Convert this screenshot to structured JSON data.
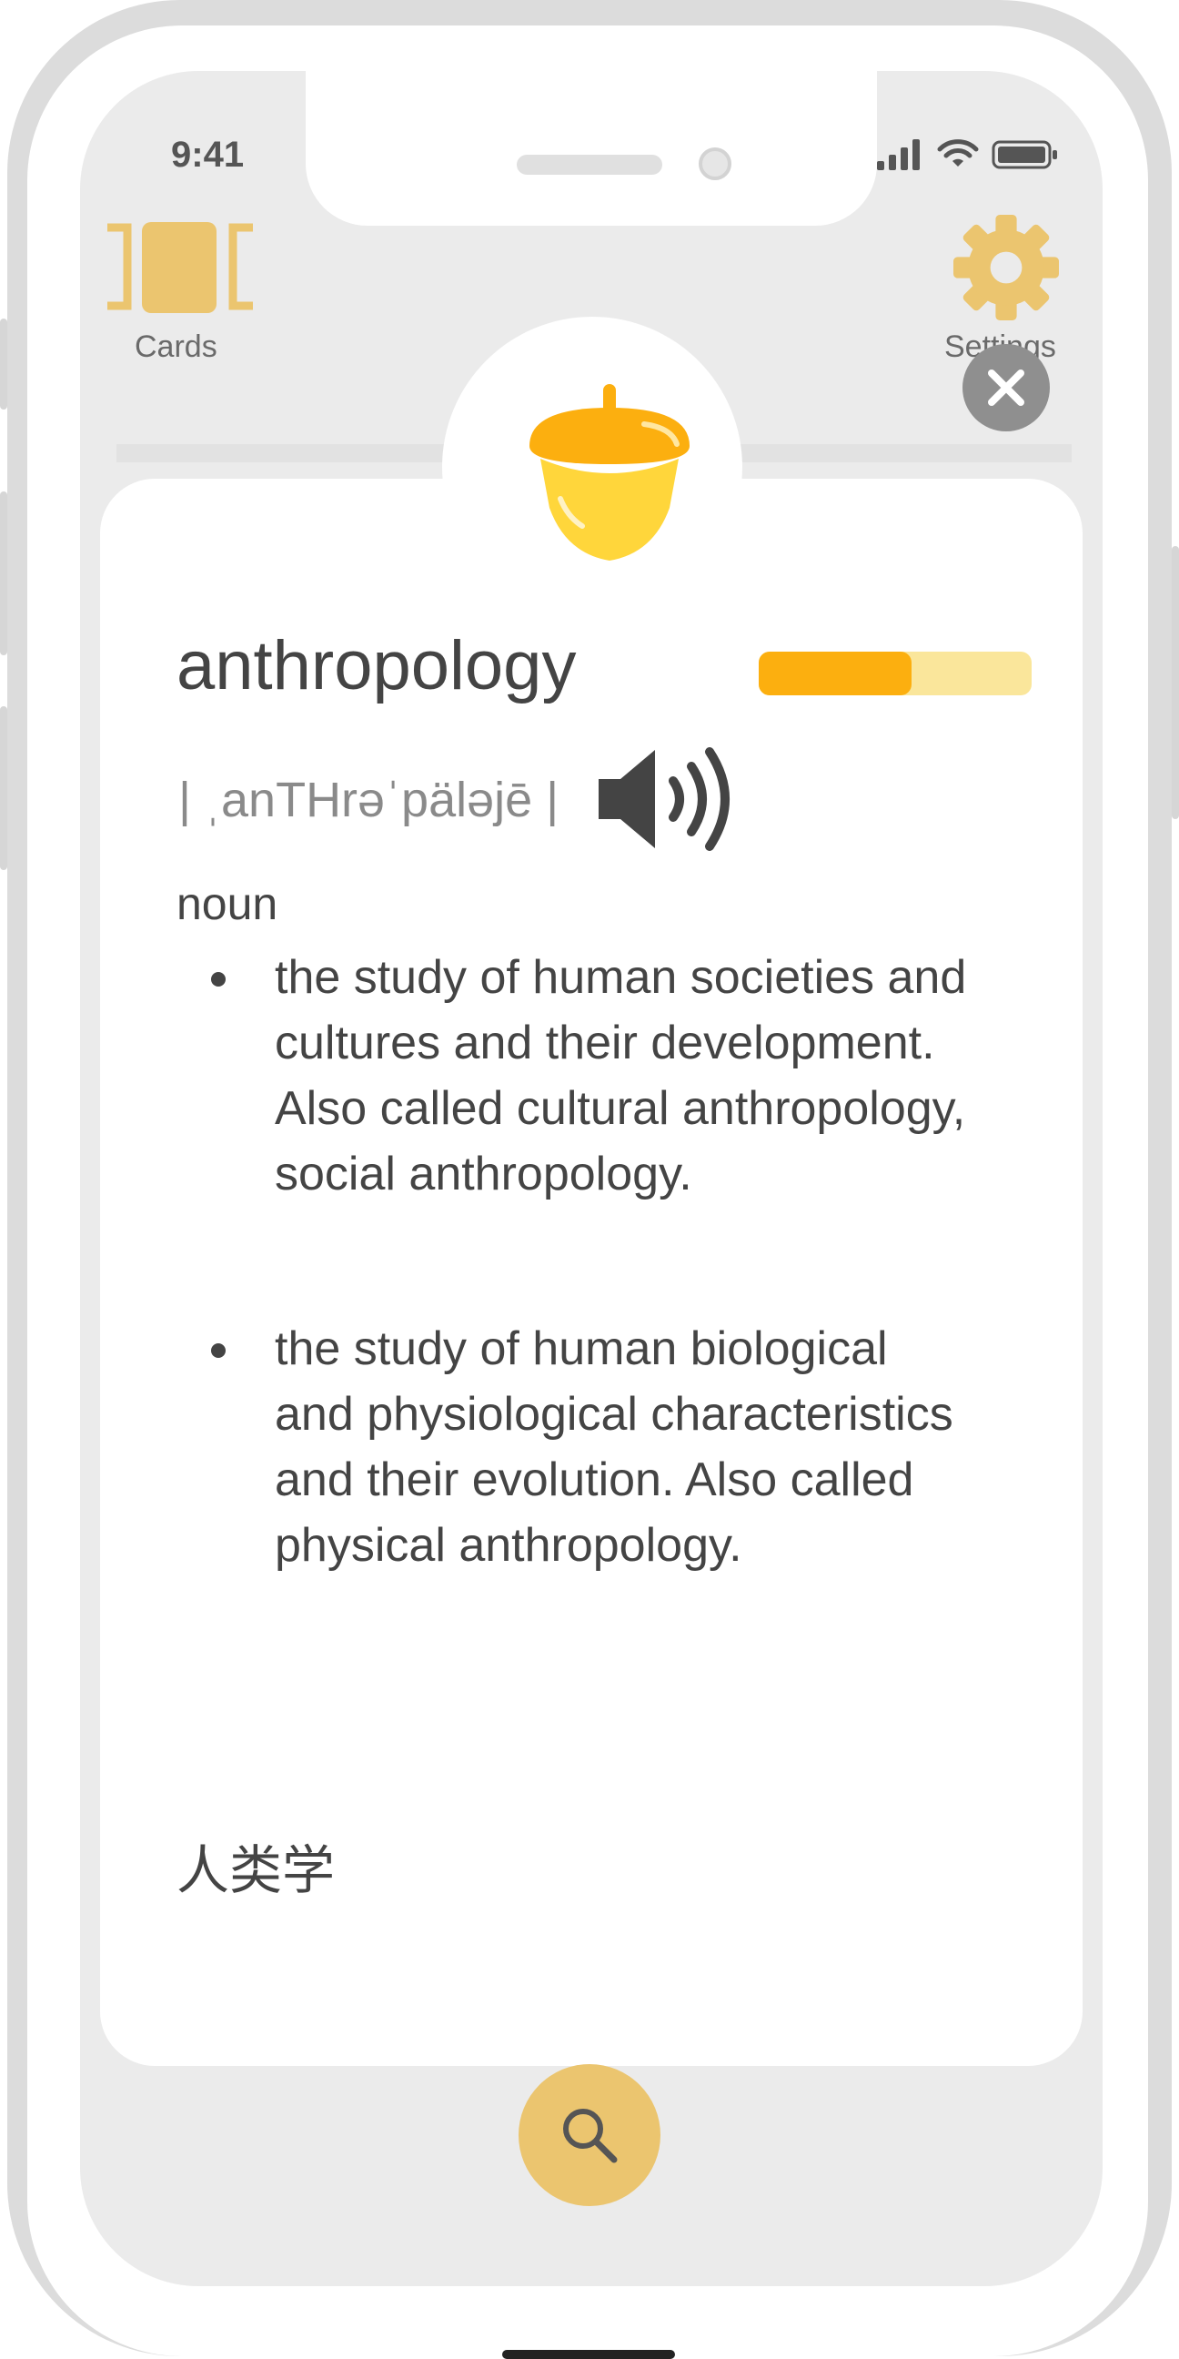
{
  "status_bar": {
    "time": "9:41"
  },
  "nav": {
    "cards_label": "Cards",
    "settings_label": "Settings"
  },
  "word_card": {
    "word": "anthropology",
    "progress": 0.56,
    "pronunciation": "| ˌanTHrəˈpäləjē |",
    "part_of_speech": "noun",
    "definitions": [
      "the study of human societies and cultures and their development. Also called cultural anthropology, social anthropology.",
      "the study of human biological and physiological characteristics and their evolution. Also called physical anthropology."
    ],
    "translation": "人类学"
  },
  "colors": {
    "accent": "#ebc56f",
    "progress_fill": "#fcaf0f",
    "progress_track": "#fae69b",
    "acorn_cap": "#fcaf0f",
    "acorn_body": "#ffd63b"
  },
  "icons": [
    "cards-icon",
    "gear-icon",
    "close-icon",
    "acorn-icon",
    "speaker-icon",
    "search-icon"
  ]
}
